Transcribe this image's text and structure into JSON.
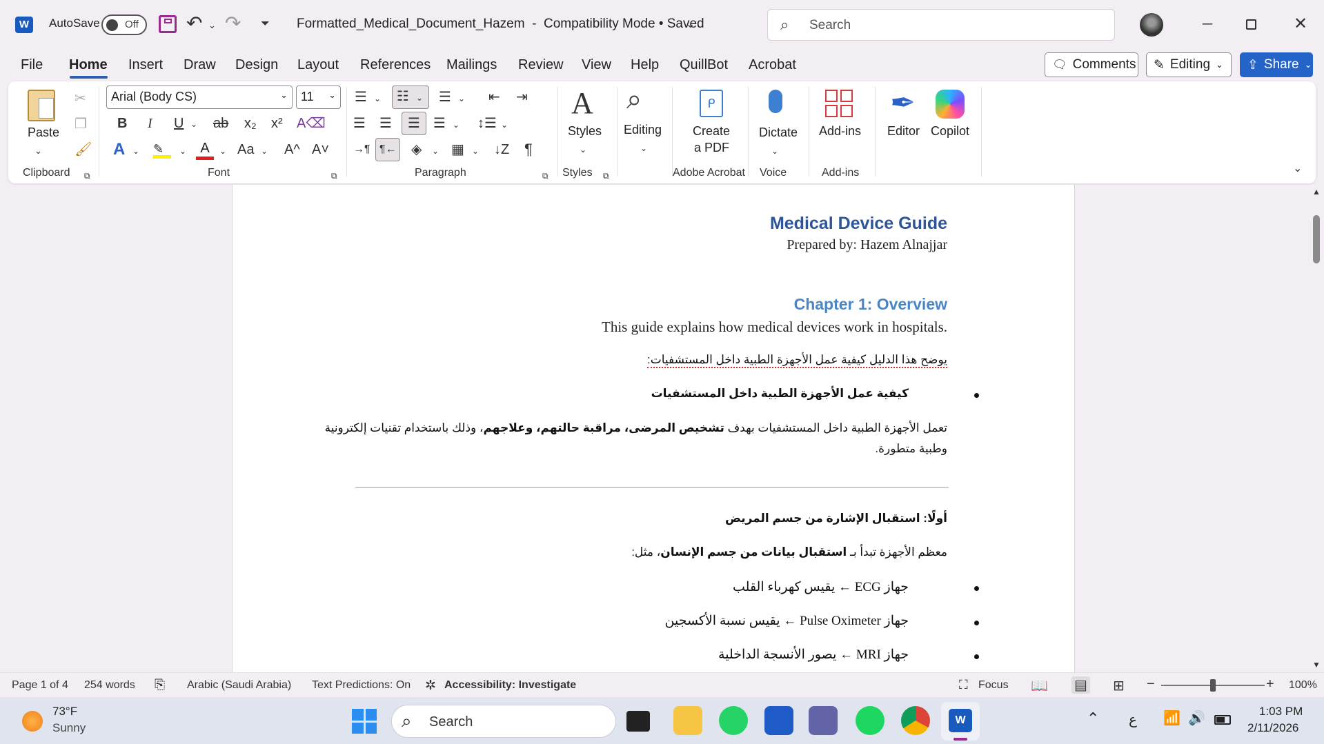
{
  "titlebar": {
    "autosave_label": "AutoSave",
    "autosave_state": "Off",
    "document_title": "Formatted_Medical_Document_Hazem  -  Compatibility Mode • Saved",
    "search_placeholder": "Search"
  },
  "tabs": [
    "File",
    "Home",
    "Insert",
    "Draw",
    "Design",
    "Layout",
    "References",
    "Mailings",
    "Review",
    "View",
    "Help",
    "QuillBot",
    "Acrobat"
  ],
  "active_tab": "Home",
  "header_buttons": {
    "comments": "Comments",
    "editing": "Editing",
    "share": "Share"
  },
  "ribbon": {
    "clipboard": {
      "paste": "Paste",
      "label": "Clipboard"
    },
    "font": {
      "font_name": "Arial (Body CS)",
      "font_size": "11",
      "label": "Font",
      "bold": "B",
      "italic": "I",
      "underline": "U",
      "strike": "ab",
      "subscript": "x₂",
      "superscript": "x²",
      "change_case": "Aa",
      "grow": "A^",
      "shrink": "A˅"
    },
    "paragraph": {
      "label": "Paragraph"
    },
    "styles": {
      "button": "Styles",
      "label": "Styles"
    },
    "editing": {
      "button": "Editing"
    },
    "acrobat": {
      "button_line1": "Create",
      "button_line2": "a PDF",
      "label": "Adobe Acrobat"
    },
    "voice": {
      "button": "Dictate",
      "label": "Voice"
    },
    "addins": {
      "button": "Add-ins",
      "label": "Add-ins"
    },
    "editor": {
      "button": "Editor"
    },
    "copilot": {
      "button": "Copilot"
    }
  },
  "document": {
    "title": "Medical Device Guide",
    "author": "Prepared by: Hazem Alnajjar",
    "chapter_heading": "Chapter 1: Overview",
    "intro_en": "This guide explains how medical devices work in hospitals.",
    "intro_ar": "يوضح هذا الدليل كيفية عمل الأجهزة الطبية داخل المستشفيات:",
    "bullet_heading": "كيفية عمل الأجهزة الطبية داخل المستشفيات",
    "para1_a": "تعمل الأجهزة الطبية داخل المستشفيات بهدف ",
    "para1_b": "تشخيص المرضى، مراقبة حالتهم، وعلاجهم",
    "para1_c": "، وذلك باستخدام تقنيات إلكترونية",
    "para1_line2": "وطبية متطورة.",
    "section_heading": "أولًا: استقبال الإشارة من جسم المريض",
    "para2_a": "معظم الأجهزة تبدأ بـ ",
    "para2_b": "استقبال بيانات من جسم الإنسان",
    "para2_c": "، مثل:",
    "devices": [
      "جهاز ECG ← يقيس كهرباء القلب",
      "جهاز Pulse Oximeter ← يقيس نسبة الأكسجين",
      "جهاز MRI ← يصور الأنسجة الداخلية"
    ]
  },
  "statusbar": {
    "page": "Page 1 of 4",
    "words": "254 words",
    "language": "Arabic (Saudi Arabia)",
    "predictions": "Text Predictions: On",
    "accessibility": "Accessibility: Investigate",
    "focus": "Focus",
    "zoom": "100%"
  },
  "taskbar": {
    "weather_temp": "73°F",
    "weather_desc": "Sunny",
    "search_placeholder": "Search",
    "lang_indicator": "ع",
    "time": "1:03 PM",
    "date": "2/11/2026"
  },
  "colors": {
    "accent": "#2b5fb4",
    "heading": "#2e5597",
    "heading2": "#4a86c5",
    "share": "#2464c9",
    "spell": "#d8252a"
  }
}
